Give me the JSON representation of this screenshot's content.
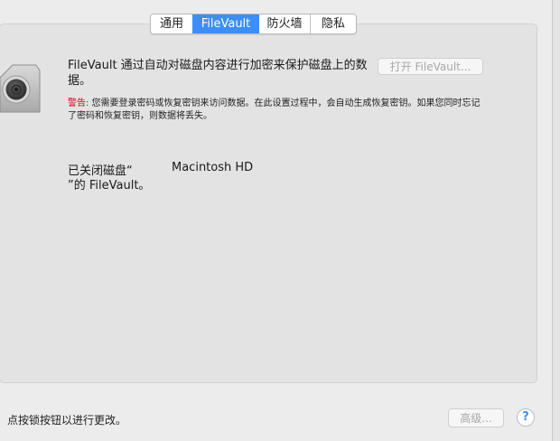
{
  "tabs": [
    {
      "label": "通用",
      "active": false
    },
    {
      "label": "FileVault",
      "active": true
    },
    {
      "label": "防火墙",
      "active": false
    },
    {
      "label": "隐私",
      "active": false
    }
  ],
  "filevault": {
    "description": "FileVault 通过自动对磁盘内容进行加密来保护磁盘上的数据。",
    "turn_on_button": "打开 FileVault...",
    "warning_prefix": "警告:",
    "warning_text": " 您需要登录密码或恢复密钥来访问数据。在此设置过程中，会自动生成恢复密钥。如果您同时忘记了密码和恢复密钥，则数据将丢失。",
    "status_prefix": "已关闭磁盘“",
    "disk_name": "Macintosh HD",
    "status_suffix": "”的 FileVault。"
  },
  "footer": {
    "lock_hint": "点按锁按钮以进行更改。",
    "advanced_button": "高级...",
    "help_label": "?"
  },
  "colors": {
    "accent": "#3d8ef5",
    "warning": "#d0021b",
    "disabled_text": "#a7a7a7"
  }
}
